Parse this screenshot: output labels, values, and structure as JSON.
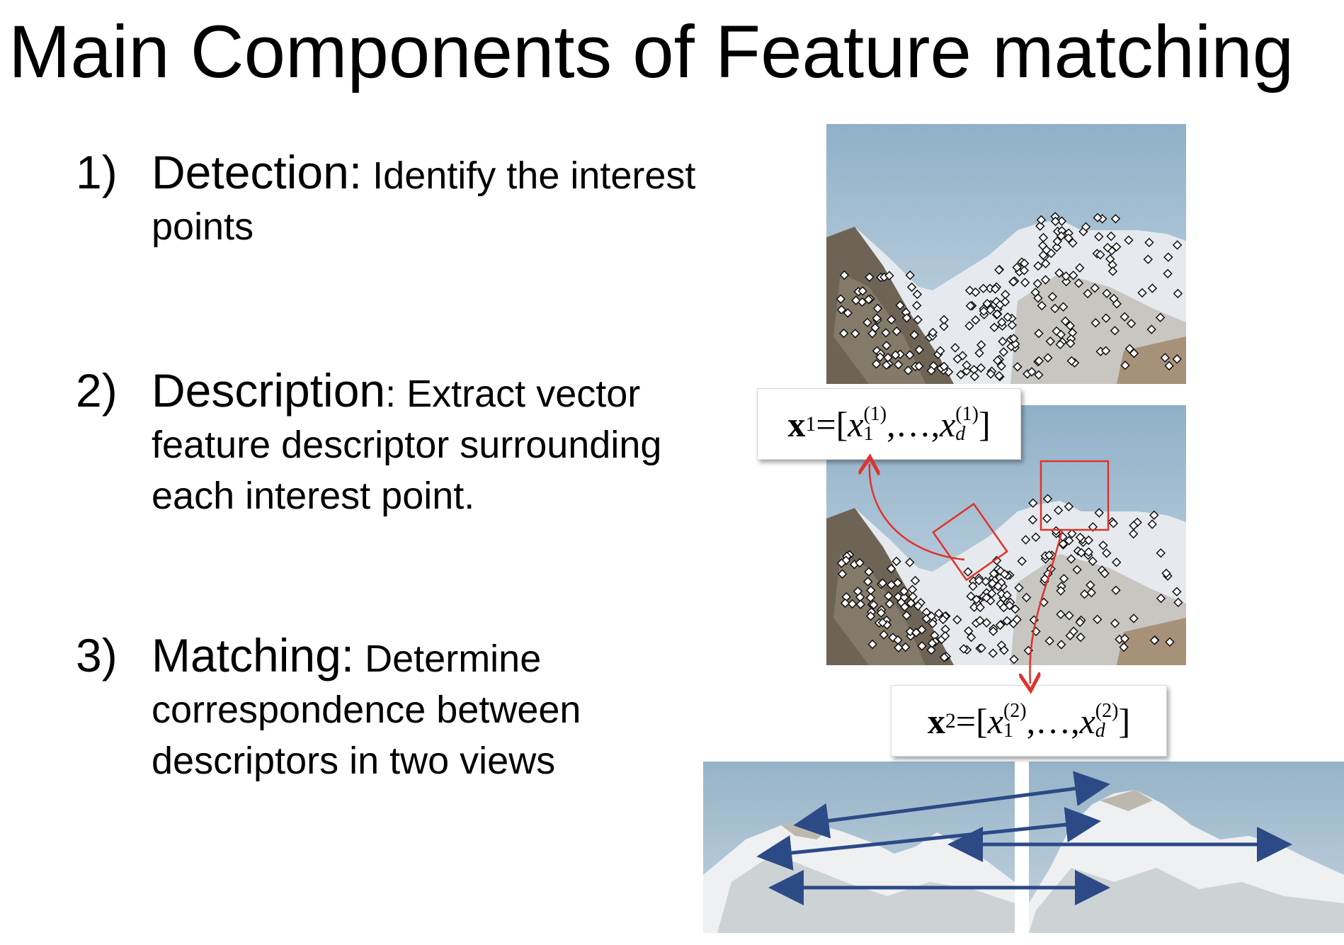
{
  "slide": {
    "title": "Main Components of Feature matching"
  },
  "steps": [
    {
      "number": "1)",
      "heading": "Detection:",
      "text_inline": " Identify the interest",
      "text_rest": "points"
    },
    {
      "number": "2)",
      "heading": "Description",
      "text_inline": ": Extract vector",
      "text_rest": "feature descriptor surrounding each interest point."
    },
    {
      "number": "3)",
      "heading": "Matching:",
      "text_inline": " Determine",
      "text_rest": "correspondence between descriptors in two views"
    }
  ],
  "formulas": {
    "x1": {
      "var": "x",
      "index": "1",
      "eq": " =[",
      "first": "x",
      "first_sub": "1",
      "first_sup": "(1)",
      "dots": ",…,",
      "last": "x",
      "last_sub": "d",
      "last_sup": "(1)",
      "close": "]"
    },
    "x2": {
      "var": "x",
      "index": "2",
      "eq": " =[",
      "first": "x",
      "first_sub": "1",
      "first_sup": "(2)",
      "dots": ",…,",
      "last": "x",
      "last_sub": "d",
      "last_sup": "(2)",
      "close": "]"
    }
  },
  "colors": {
    "annotation_red": "#e0322a",
    "match_arrow_blue": "#2b4a86",
    "sky": "#9db8cf",
    "rock": "#7a7060",
    "snow": "#eef0f2"
  },
  "icons": {
    "keypoint": "diamond-marker-icon"
  }
}
